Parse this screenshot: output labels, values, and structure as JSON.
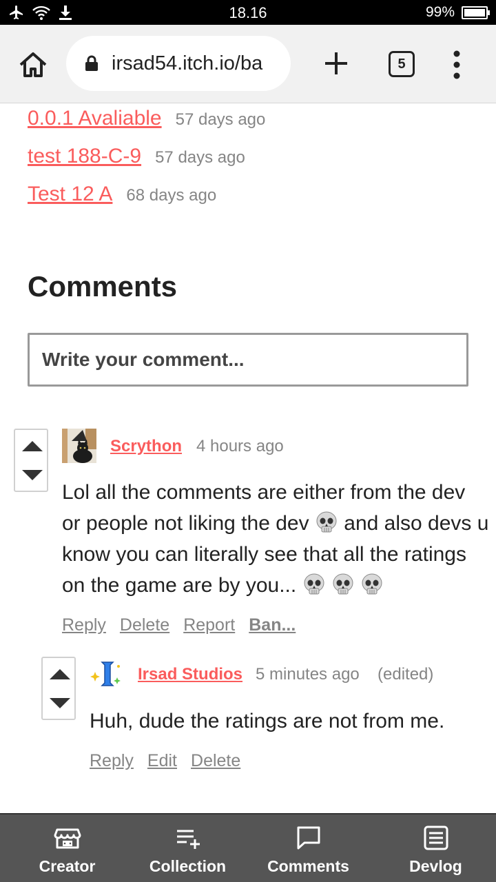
{
  "status_bar": {
    "time": "18.16",
    "battery_text": "99%",
    "battery_level": 0.99,
    "icons": [
      "airplane-icon",
      "wifi-icon",
      "download-icon"
    ]
  },
  "browser": {
    "url": "irsad54.itch.io/ba",
    "tab_count": "5",
    "icons": [
      "home-icon",
      "lock-icon",
      "plus-icon",
      "tabs-icon",
      "more-vert-icon"
    ]
  },
  "devlogs": [
    {
      "title": "0.0.1 Avaliable",
      "date": "57 days ago"
    },
    {
      "title": "test 188-C-9",
      "date": "57 days ago"
    },
    {
      "title": "Test 12 A",
      "date": "68 days ago"
    }
  ],
  "comments_section": {
    "title": "Comments",
    "input_placeholder": "Write your comment..."
  },
  "comments": [
    {
      "author": "Scrython",
      "time": "4 hours ago",
      "body_parts": [
        "Lol all the comments are either from the dev or people not liking the dev ",
        " and also devs u know you can literally see that all the ratings on the game are by you... "
      ],
      "actions": [
        "Reply",
        "Delete",
        "Report",
        "Ban..."
      ]
    },
    {
      "author": "Irsad Studios",
      "time": "5 minutes ago",
      "edited": "(edited)",
      "body": "Huh, dude the ratings are not from me.",
      "actions": [
        "Reply",
        "Edit",
        "Delete"
      ]
    }
  ],
  "bottom_nav": [
    {
      "label": "Creator",
      "icon": "store-icon"
    },
    {
      "label": "Collection",
      "icon": "playlist-add-icon"
    },
    {
      "label": "Comments",
      "icon": "comment-icon"
    },
    {
      "label": "Devlog",
      "icon": "article-icon"
    }
  ],
  "colors": {
    "accent": "#fa5c5c",
    "muted": "#858585",
    "nav_bg": "#555555",
    "browser_bg": "#f1f1f1"
  }
}
